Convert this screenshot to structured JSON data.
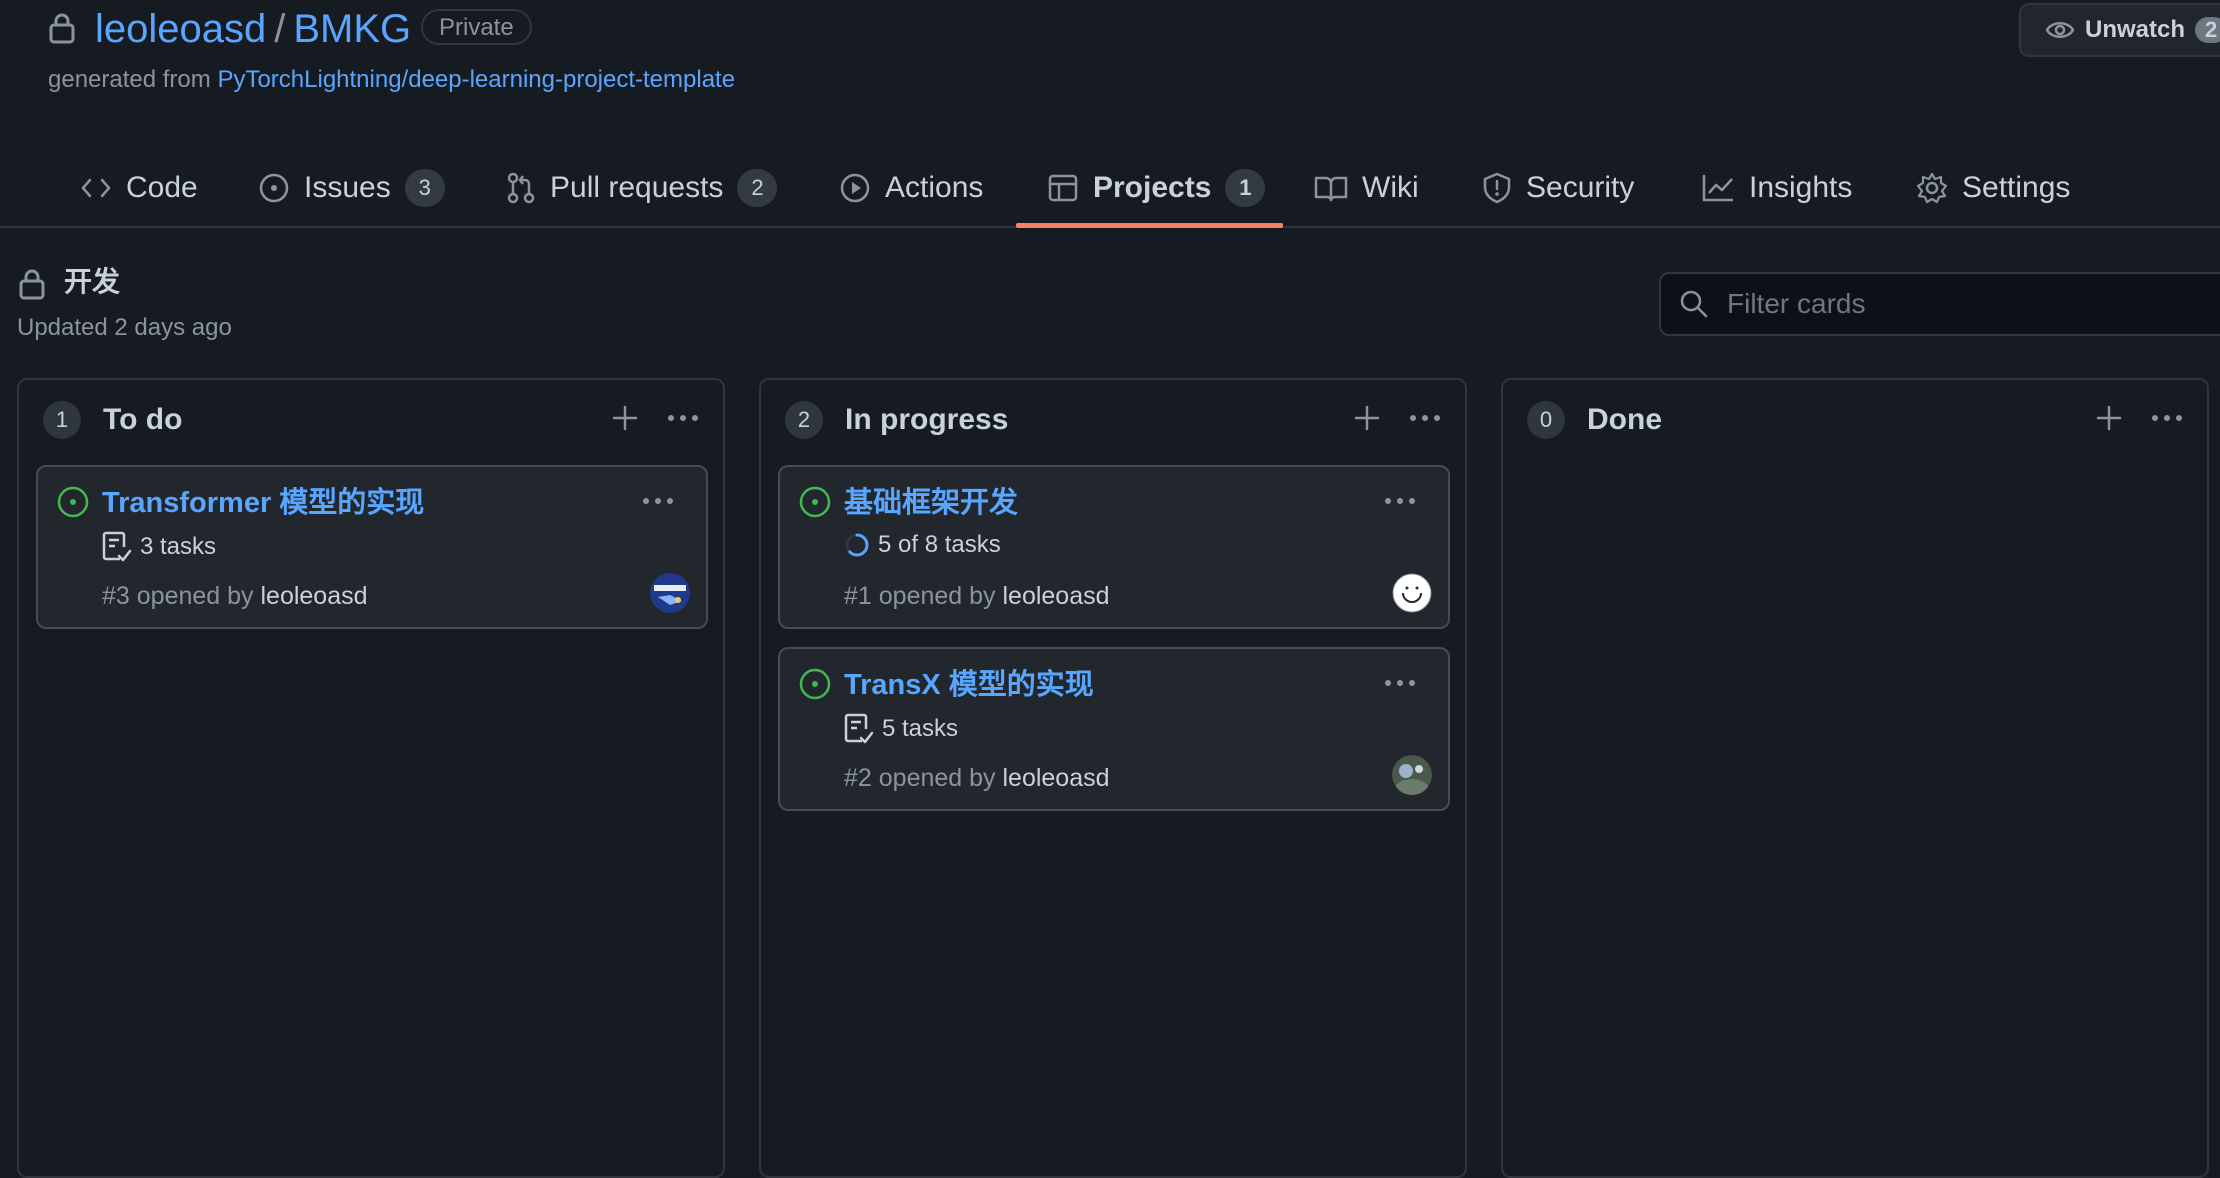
{
  "repo": {
    "owner": "leoleoasd",
    "separator": "/",
    "name": "BMKG",
    "visibility": "Private",
    "generated_prefix": "generated from ",
    "template_link": "PyTorchLightning/deep-learning-project-template",
    "unwatch_label": "Unwatch",
    "unwatch_count": "2"
  },
  "nav": {
    "tabs": [
      {
        "label": "Code",
        "icon": "code-icon"
      },
      {
        "label": "Issues",
        "count": "3",
        "icon": "issue-icon"
      },
      {
        "label": "Pull requests",
        "count": "2",
        "icon": "pull-request-icon"
      },
      {
        "label": "Actions",
        "icon": "play-icon"
      },
      {
        "label": "Projects",
        "count": "1",
        "icon": "table-icon",
        "selected": true
      },
      {
        "label": "Wiki",
        "icon": "book-icon"
      },
      {
        "label": "Security",
        "icon": "shield-icon"
      },
      {
        "label": "Insights",
        "icon": "graph-icon"
      },
      {
        "label": "Settings",
        "icon": "gear-icon"
      }
    ]
  },
  "project": {
    "title": "开发",
    "updated": "Updated 2 days ago",
    "filter_placeholder": "Filter cards"
  },
  "columns": [
    {
      "count": "1",
      "name": "To do",
      "cards": [
        {
          "title": "Transformer 模型的实现",
          "tasks": "3 tasks",
          "tasks_icon": "checklist-icon",
          "number": "#3",
          "opened_by": " opened by ",
          "user": "leoleoasd"
        }
      ]
    },
    {
      "count": "2",
      "name": "In progress",
      "cards": [
        {
          "title": "基础框架开发",
          "tasks": "5 of 8 tasks",
          "tasks_icon": "progress-ring-icon",
          "progress": 0.625,
          "number": "#1",
          "opened_by": " opened by ",
          "user": "leoleoasd"
        },
        {
          "title": "TransX 模型的实现",
          "tasks": "5 tasks",
          "tasks_icon": "checklist-icon",
          "number": "#2",
          "opened_by": " opened by ",
          "user": "leoleoasd"
        }
      ]
    },
    {
      "count": "0",
      "name": "Done",
      "cards": []
    }
  ],
  "colors": {
    "background": "#161b22",
    "link": "#58a6ff",
    "open_issue": "#3fb950",
    "selected_tab_underline": "#f78166"
  }
}
